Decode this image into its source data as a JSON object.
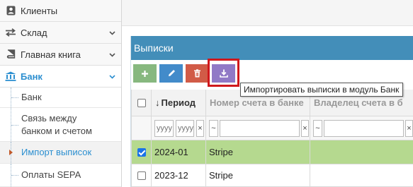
{
  "sidebar": {
    "clients": "Клиенты",
    "warehouse": "Склад",
    "ledger": "Главная книга",
    "bank": "Банк",
    "bank_items": [
      {
        "label": "Банк"
      },
      {
        "label": "Связь между банком и счетом"
      },
      {
        "label": "Импорт выписок"
      },
      {
        "label": "Оплаты SEPA"
      }
    ]
  },
  "panel": {
    "title": "Выписки",
    "tooltip": "Импортировать выписки в модуль Банк",
    "toolbar": {
      "add_icon": "plus-icon",
      "edit_icon": "pencil-icon",
      "delete_icon": "trash-icon",
      "import_icon": "download-icon"
    }
  },
  "grid": {
    "sort_indicator": "↓",
    "columns": [
      "Период",
      "Номер счета в банке",
      "Владелец счета в б"
    ],
    "filters": {
      "period_from_placeholder": "yyyy",
      "period_to_placeholder": "yyyy",
      "clear": "×",
      "operator": "~"
    },
    "rows": [
      {
        "period": "2024-01",
        "account_number": "Stripe",
        "owner": "",
        "selected": true
      },
      {
        "period": "2023-12",
        "account_number": "Stripe",
        "owner": "",
        "selected": false
      }
    ]
  },
  "colors": {
    "header_blue": "#438eb9",
    "selected_row": "#b5d98f",
    "highlight_border": "#d0181c",
    "add_green": "#87b87f",
    "edit_blue": "#428bca",
    "delete_red": "#d15b47",
    "import_purple": "#9079c6"
  }
}
